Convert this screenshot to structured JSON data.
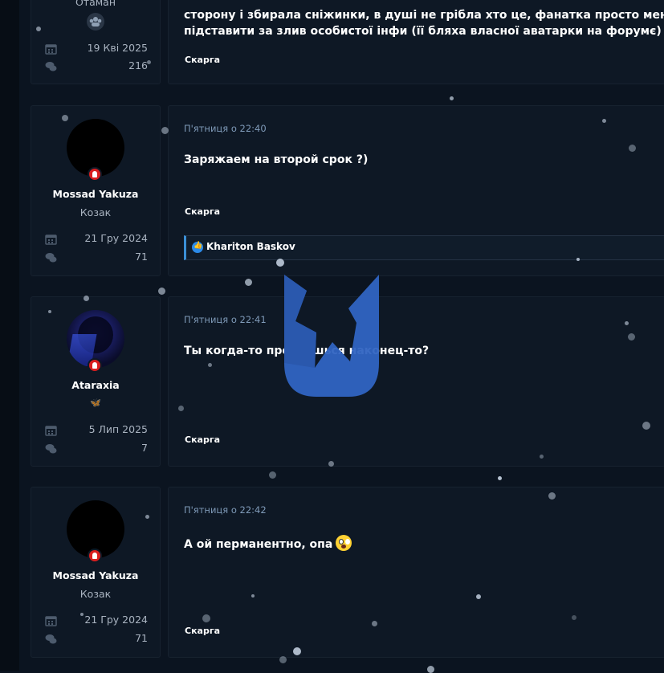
{
  "posts": [
    {
      "user_title": "Отаман",
      "joined": "19 Кві 2025",
      "messages": "216",
      "text_lines": [
        "сторону і збирала сніжинки, в душі не грібла хто це, фанатка просто мене в",
        "підставити за злив особистої інфи (її бляха власної аватарки на форумє) що"
      ],
      "report": "Скарга"
    },
    {
      "username": "Mossad Yakuza",
      "user_title": "Козак",
      "joined": "21 Гру 2024",
      "messages": "71",
      "date": "П'ятниця о 22:40",
      "text": "Заряжаем на второй срок ?)",
      "report": "Скарга",
      "reaction_user": "Khariton Baskov"
    },
    {
      "username": "Ataraxia",
      "user_title": "🦋",
      "joined": "5 Лип 2025",
      "messages": "7",
      "date": "П'ятниця о 22:41",
      "text": "Ты когда-то проспишься наконец-то?",
      "report": "Скарга"
    },
    {
      "username": "Mossad Yakuza",
      "user_title": "Козак",
      "joined": "21 Гру 2024",
      "messages": "71",
      "date": "П'ятниця о 22:42",
      "text": "А ой перманентно, опа",
      "report": "Скарга"
    }
  ],
  "colors": {
    "background": "#0b1420",
    "panel": "#0e1825",
    "accent": "#3b6fd0",
    "online": "#d81e1e",
    "date": "#7f9ab8"
  }
}
